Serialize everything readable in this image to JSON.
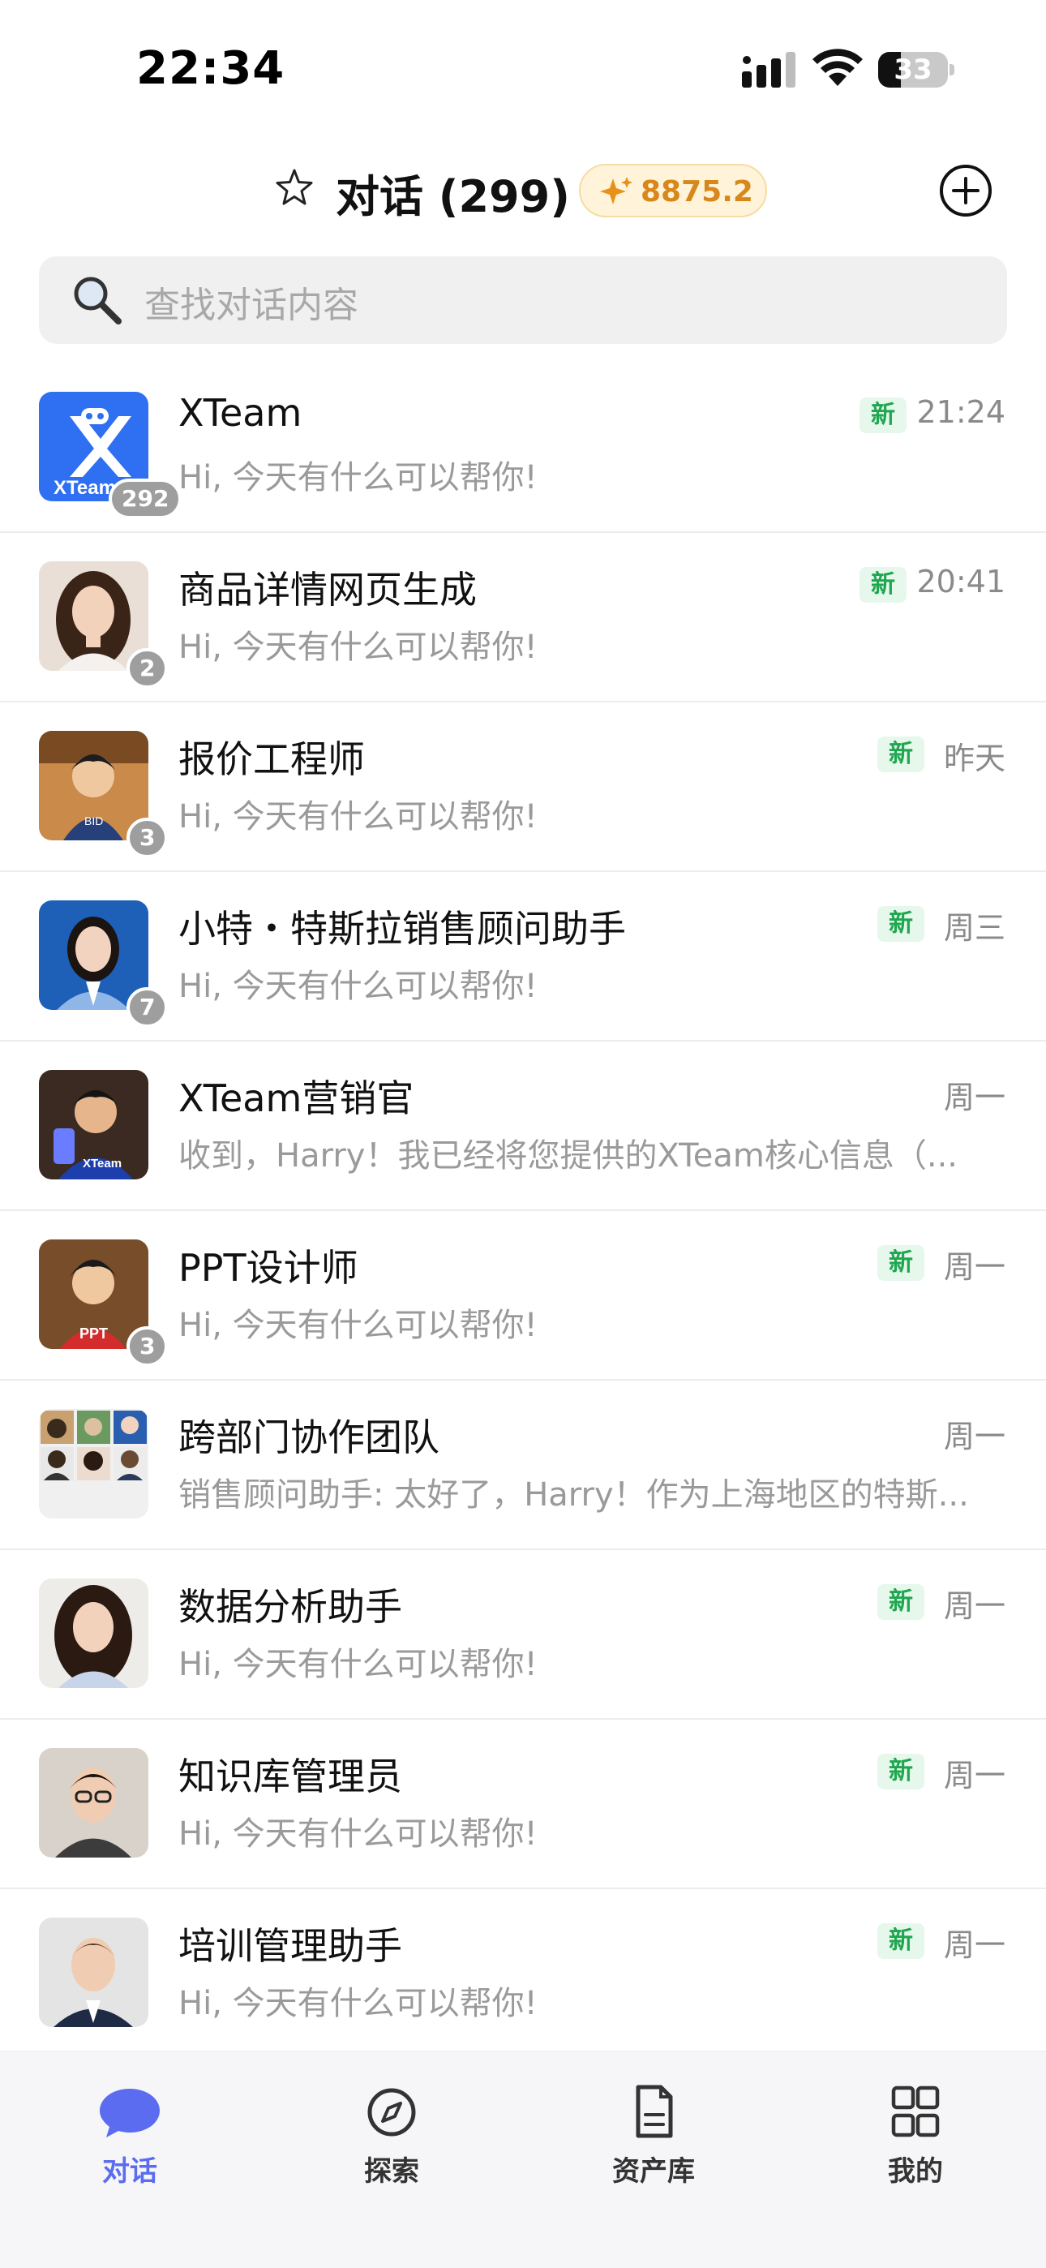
{
  "status_bar": {
    "time": "22:34",
    "battery": "33",
    "battery_level": 0.33
  },
  "header": {
    "title": "对话 (299)",
    "credits": "8875.2"
  },
  "search": {
    "placeholder": "查找对话内容"
  },
  "chats": [
    {
      "name": "XTeam",
      "preview": "Hi, 今天有什么可以帮你!",
      "time": "21:24",
      "new_label": "新",
      "unread": "292",
      "avatar_text": "XTeam"
    },
    {
      "name": "商品详情网页生成",
      "preview": "Hi, 今天有什么可以帮你!",
      "time": "20:41",
      "new_label": "新",
      "unread": "2"
    },
    {
      "name": "报价工程师",
      "preview": "Hi, 今天有什么可以帮你!",
      "time": "昨天",
      "new_label": "新",
      "unread": "3"
    },
    {
      "name": "小特・特斯拉销售顾问助手",
      "preview": "Hi, 今天有什么可以帮你!",
      "time": "周三",
      "new_label": "新",
      "unread": "7"
    },
    {
      "name": "XTeam营销官",
      "preview": "收到，Harry！我已经将您提供的XTeam核心信息（...",
      "time": "周一"
    },
    {
      "name": "PPT设计师",
      "preview": "Hi, 今天有什么可以帮你!",
      "time": "周一",
      "new_label": "新",
      "unread": "3"
    },
    {
      "name": "跨部门协作团队",
      "preview": "销售顾问助手: 太好了，Harry！作为上海地区的特斯...",
      "time": "周一"
    },
    {
      "name": "数据分析助手",
      "preview": "Hi, 今天有什么可以帮你!",
      "time": "周一",
      "new_label": "新"
    },
    {
      "name": "知识库管理员",
      "preview": "Hi, 今天有什么可以帮你!",
      "time": "周一",
      "new_label": "新"
    },
    {
      "name": "培训管理助手",
      "preview": "Hi, 今天有什么可以帮你!",
      "time": "周一",
      "new_label": "新"
    }
  ],
  "tabs": [
    {
      "label": "对话",
      "icon": "chat-bubble-icon",
      "active": true
    },
    {
      "label": "探索",
      "icon": "compass-icon"
    },
    {
      "label": "资产库",
      "icon": "document-icon"
    },
    {
      "label": "我的",
      "icon": "grid-icon"
    }
  ],
  "colors": {
    "accent": "#5b6cf0",
    "new_badge_text": "#1fa750",
    "new_badge_bg": "#e6f7ec",
    "credits_text": "#d8871a"
  }
}
